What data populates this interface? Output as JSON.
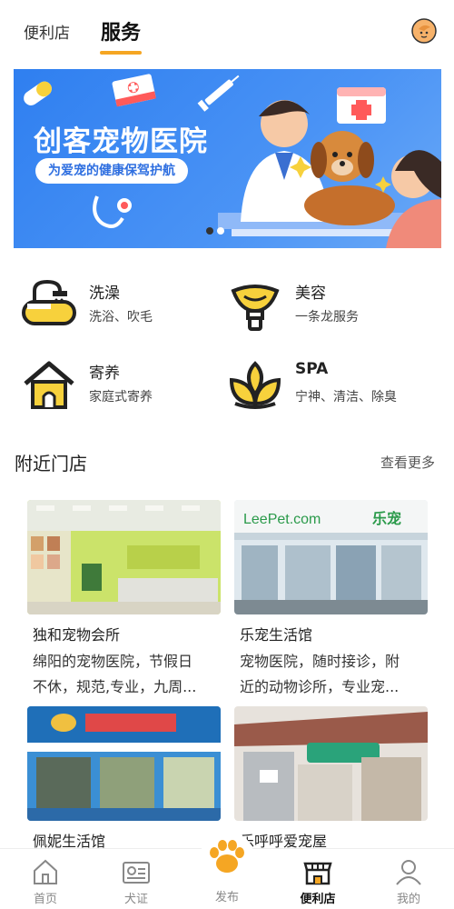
{
  "header": {
    "tab_convenience": "便利店",
    "tab_service": "服务"
  },
  "banner": {
    "title": "创客宠物医院",
    "subtitle": "为爱宠的健康保驾护航"
  },
  "services": [
    {
      "title": "洗澡",
      "subtitle": "洗浴、吹毛",
      "icon": "bath-icon"
    },
    {
      "title": "美容",
      "subtitle": "一条龙服务",
      "icon": "grooming-icon"
    },
    {
      "title": "寄养",
      "subtitle": "家庭式寄养",
      "icon": "house-icon"
    },
    {
      "title": "SPA",
      "subtitle": "宁神、清洁、除臭",
      "icon": "lotus-icon"
    }
  ],
  "nearby": {
    "title": "附近门店",
    "more": "查看更多",
    "stores": [
      {
        "name": "独和宠物会所",
        "desc_line1": "绵阳的宠物医院，节假日",
        "desc_line2": "不休，规范,专业，九周..."
      },
      {
        "name": "乐宠生活馆",
        "desc_line1": "宠物医院，随时接诊，附",
        "desc_line2": "近的动物诊所，专业宠..."
      },
      {
        "name": "佩妮生活馆",
        "desc_line1": "",
        "desc_line2": ""
      },
      {
        "name": "乐呼呼爱宠屋",
        "desc_line1": "",
        "desc_line2": ""
      }
    ]
  },
  "bottom_nav": [
    {
      "label": "首页",
      "icon": "home-icon"
    },
    {
      "label": "犬证",
      "icon": "id-card-icon"
    },
    {
      "label": "发布",
      "icon": "paw-icon"
    },
    {
      "label": "便利店",
      "icon": "store-icon"
    },
    {
      "label": "我的",
      "icon": "user-icon"
    }
  ],
  "colors": {
    "accent": "#f5a623",
    "banner_blue": "#2f7ff0",
    "icon_yellow": "#f7d13c"
  }
}
